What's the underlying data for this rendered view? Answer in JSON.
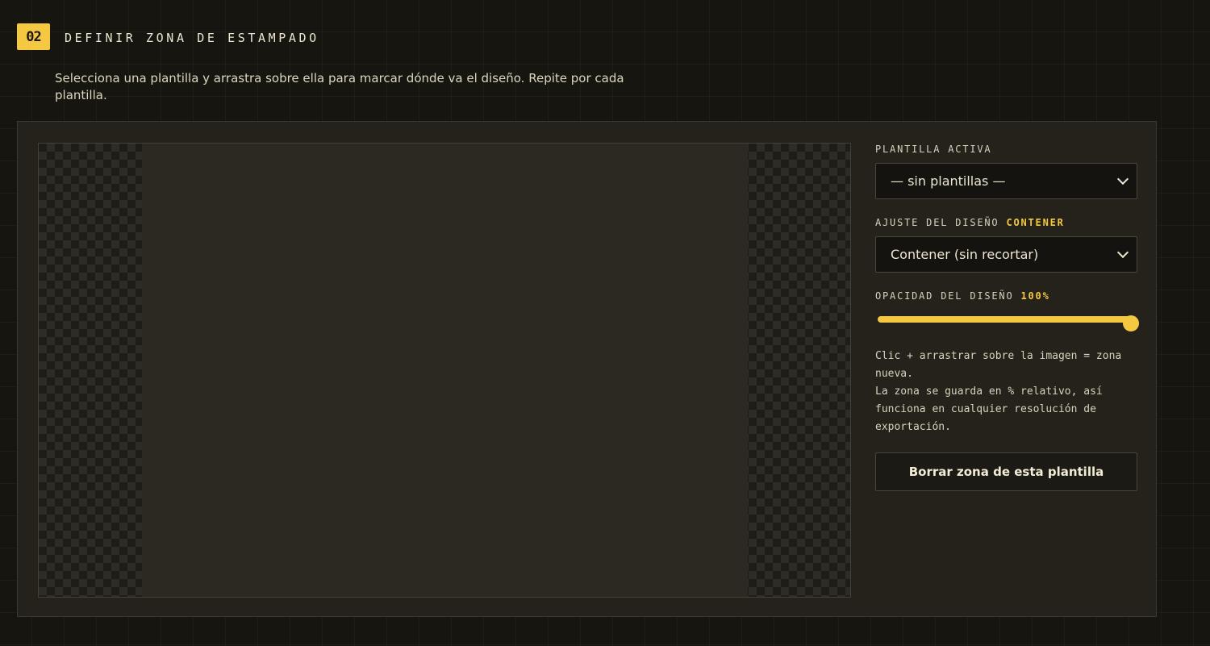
{
  "step": {
    "number": "02",
    "title": "DEFINIR ZONA DE ESTAMPADO",
    "description": "Selecciona una plantilla y arrastra sobre ella para marcar dónde va el diseño. Repite por cada plantilla."
  },
  "controls": {
    "active_template": {
      "label": "PLANTILLA ACTIVA",
      "selected": "— sin plantillas —"
    },
    "fit": {
      "label": "AJUSTE DEL DISEÑO",
      "value_badge": "CONTENER",
      "selected": "Contener (sin recortar)"
    },
    "opacity": {
      "label": "OPACIDAD DEL DISEÑO",
      "value_badge": "100%",
      "value": 1.0
    },
    "help_lines": [
      "Clic + arrastrar sobre la imagen = zona nueva.",
      "La zona se guarda en % relativo, así funciona en cualquier resolución de exportación."
    ],
    "clear_button": "Borrar zona de esta plantilla"
  },
  "colors": {
    "accent": "#f5c842",
    "panel": "#24221b",
    "background": "#161510"
  },
  "icons": {
    "select_chevron": "chevron-down-icon"
  }
}
